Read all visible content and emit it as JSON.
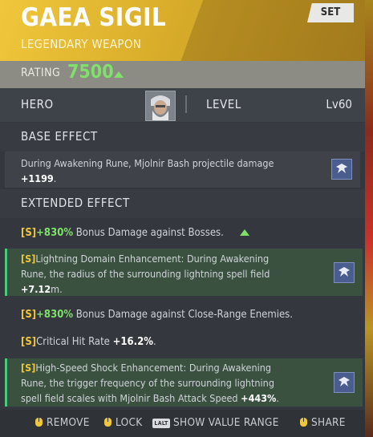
{
  "item": {
    "name": "GAEA SIGIL",
    "category": "LEGENDARY WEAPON",
    "set_tag": "SET"
  },
  "rating": {
    "label": "RATING",
    "value": "7500"
  },
  "hero": {
    "label": "HERO",
    "level_label": "LEVEL",
    "level_value": "Lv60"
  },
  "base_effect": {
    "heading": "BASE EFFECT",
    "line1": "During Awakening Rune, Mjolnir Bash projectile damage",
    "value": "+1199",
    "suffix": "."
  },
  "extended_effect": {
    "heading": "EXTENDED EFFECT",
    "effects": [
      {
        "tier": "[S]",
        "value": "+830%",
        "text": " Bonus Damage against Bosses."
      },
      {
        "tier": "[S]",
        "line1": "Lightning Domain Enhancement: During Awakening",
        "line2": "Rune, the radius of the surrounding lightning spell field",
        "value": "+7.12",
        "suffix": "m."
      },
      {
        "tier": "[S]",
        "value": "+830%",
        "text": " Bonus Damage against Close-Range Enemies."
      },
      {
        "tier": "[S]",
        "text": "Critical Hit Rate ",
        "value": "+16.2%",
        "suffix": "."
      },
      {
        "tier": "[S]",
        "line1": "High-Speed Shock Enhancement: During Awakening",
        "line2": "Rune, the trigger frequency of the surrounding lightning",
        "line3": "spell field scales with Mjolnir Bash Attack Speed ",
        "value": "+443%",
        "suffix": "."
      }
    ]
  },
  "footer": {
    "remove": "REMOVE",
    "lock": "LOCK",
    "alt_key": "LALT",
    "show_value_range": "SHOW VALUE RANGE",
    "share": "SHARE"
  },
  "colors": {
    "header_gold": "#f0c73c",
    "rating_green": "#7fe06a",
    "tier_gold": "#f0c63a",
    "highlight_green": "#4ec77b"
  }
}
